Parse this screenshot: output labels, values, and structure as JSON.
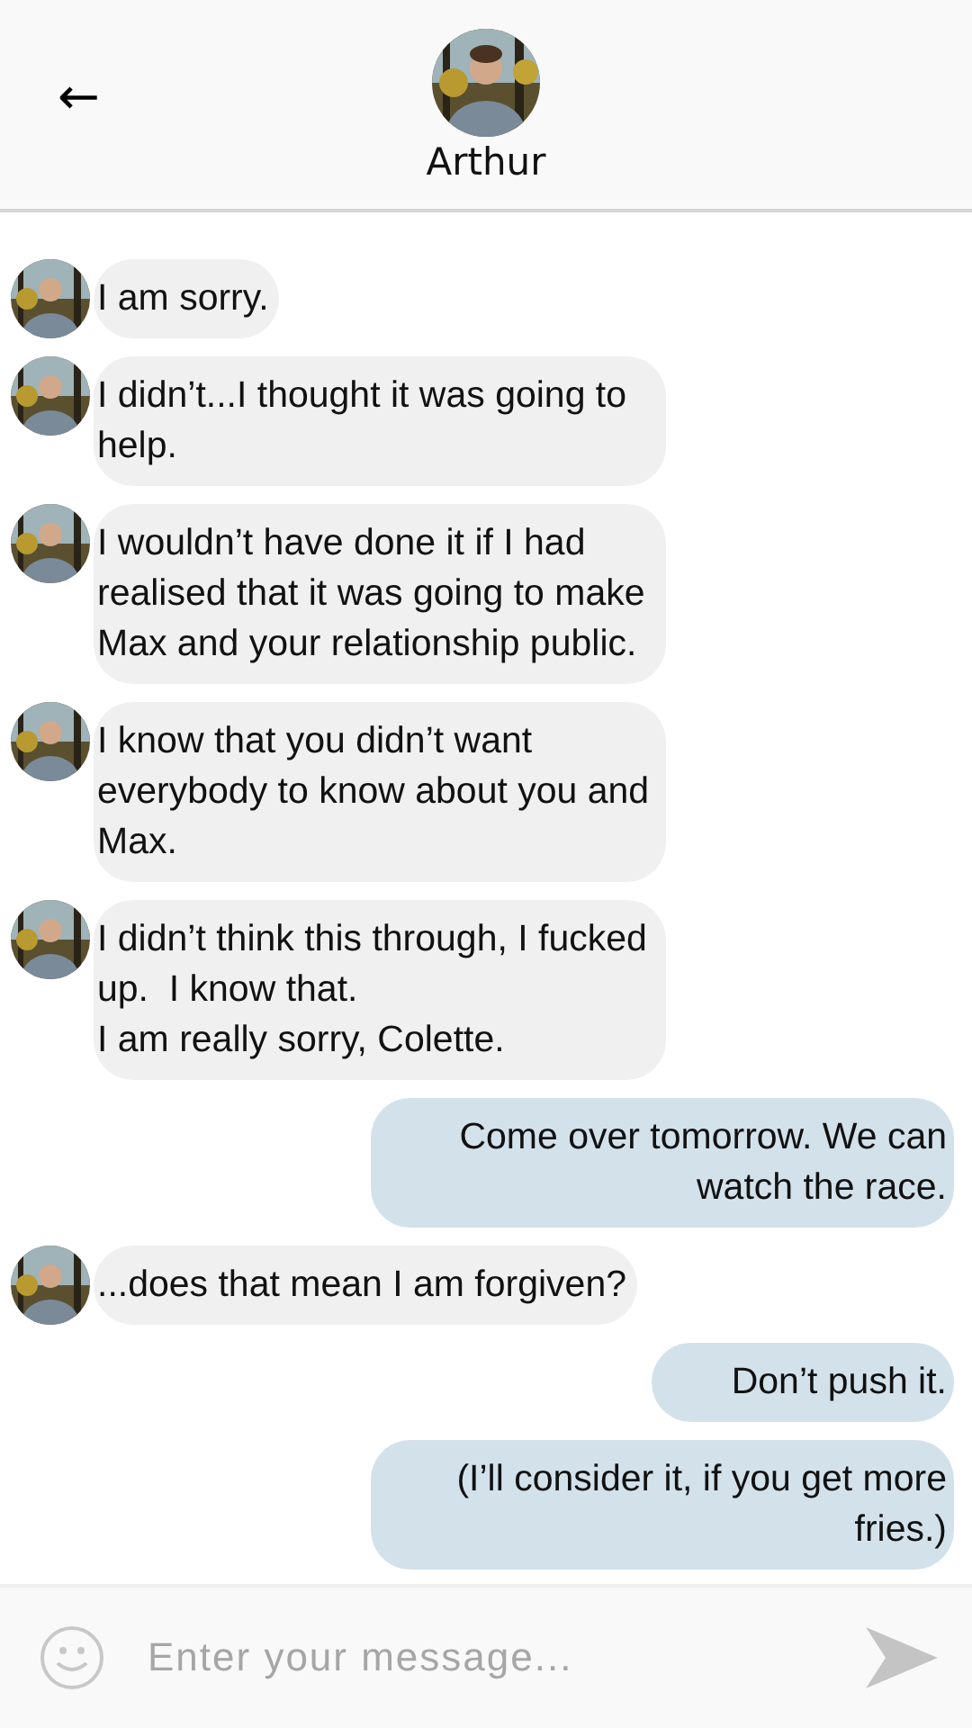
{
  "header": {
    "back": "←",
    "name": "Arthur"
  },
  "messages": [
    {
      "kind": "received",
      "text": "I am sorry."
    },
    {
      "kind": "received",
      "text": "I didn’t...I thought it was going to help."
    },
    {
      "kind": "received",
      "text": "I wouldn’t have done it if I had realised that it was going to make Max and your relationship public."
    },
    {
      "kind": "received",
      "text": "I know that you didn’t want everybody to know about you and Max."
    },
    {
      "kind": "received",
      "text": "I didn’t think this through, I fucked up.  I know that.\nI am really sorry, Colette."
    },
    {
      "kind": "sent",
      "text": "Come over tomorrow. We can watch the race."
    },
    {
      "kind": "received",
      "text": "...does that mean I am forgiven?"
    },
    {
      "kind": "sent",
      "text": "Don’t push it."
    },
    {
      "kind": "sent",
      "text": "(I’ll consider it, if you get more fries.)"
    }
  ],
  "composer": {
    "placeholder": "Enter your message..."
  }
}
